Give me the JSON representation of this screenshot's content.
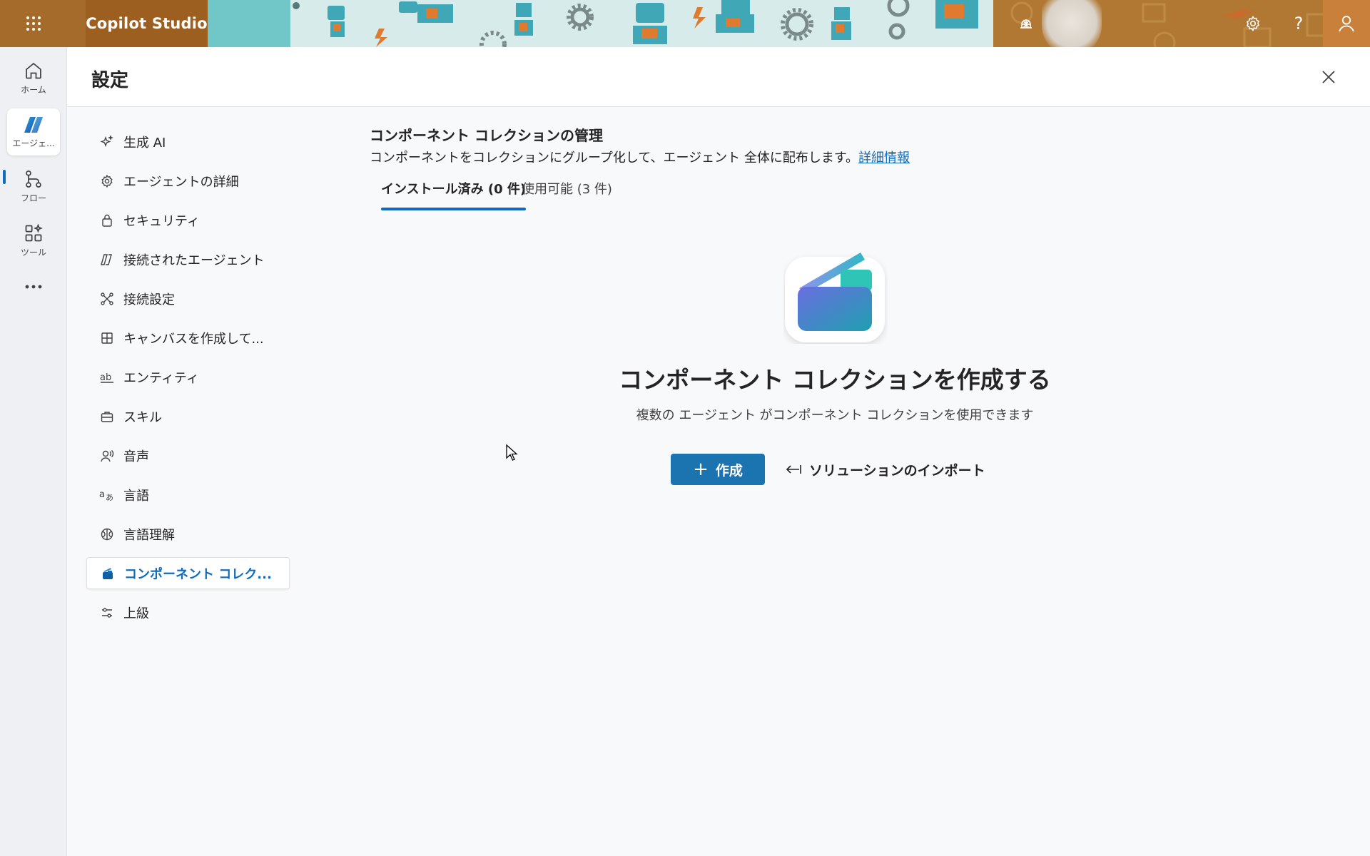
{
  "header": {
    "app_title": "Copilot Studio",
    "help_label": "?"
  },
  "rail": {
    "items": [
      {
        "label": "ホーム",
        "icon": "home-icon"
      },
      {
        "label": "エージェ...",
        "icon": "agent-icon"
      },
      {
        "label": "フロー",
        "icon": "flow-icon"
      },
      {
        "label": "ツール",
        "icon": "tools-icon"
      }
    ],
    "more_icon": "more-icon"
  },
  "settings": {
    "title": "設定",
    "nav": [
      {
        "label": "生成 AI",
        "icon": "sparkle-icon"
      },
      {
        "label": "エージェントの詳細",
        "icon": "gear-icon"
      },
      {
        "label": "セキュリティ",
        "icon": "lock-icon"
      },
      {
        "label": "接続されたエージェント",
        "icon": "connected-agent-icon"
      },
      {
        "label": "接続設定",
        "icon": "connection-icon"
      },
      {
        "label": "キャンバスを作成して...",
        "icon": "canvas-icon"
      },
      {
        "label": "エンティティ",
        "icon": "entity-icon"
      },
      {
        "label": "スキル",
        "icon": "briefcase-icon"
      },
      {
        "label": "音声",
        "icon": "voice-icon"
      },
      {
        "label": "言語",
        "icon": "language-icon"
      },
      {
        "label": "言語理解",
        "icon": "brain-icon"
      },
      {
        "label": "コンポーネント コレク...",
        "icon": "collection-icon",
        "selected": true
      },
      {
        "label": "上級",
        "icon": "sliders-icon"
      }
    ]
  },
  "content": {
    "title": "コンポーネント コレクションの管理",
    "description": "コンポーネントをコレクションにグループ化して、エージェント 全体に配布します。",
    "learn_more": "詳細情報",
    "tabs": [
      {
        "label": "インストール済み (0 件)",
        "active": true
      },
      {
        "label": "使用可能 (3 件)",
        "active": false
      }
    ],
    "empty_state": {
      "title": "コンポーネント コレクションを作成する",
      "subtitle": "複数の エージェント がコンポーネント コレクションを使用できます",
      "create_label": "作成",
      "import_label": "ソリューションのインポート"
    }
  },
  "colors": {
    "accent": "#0f6cbd",
    "primary_button": "#1b73b0",
    "topbar": "#a56b2a"
  }
}
